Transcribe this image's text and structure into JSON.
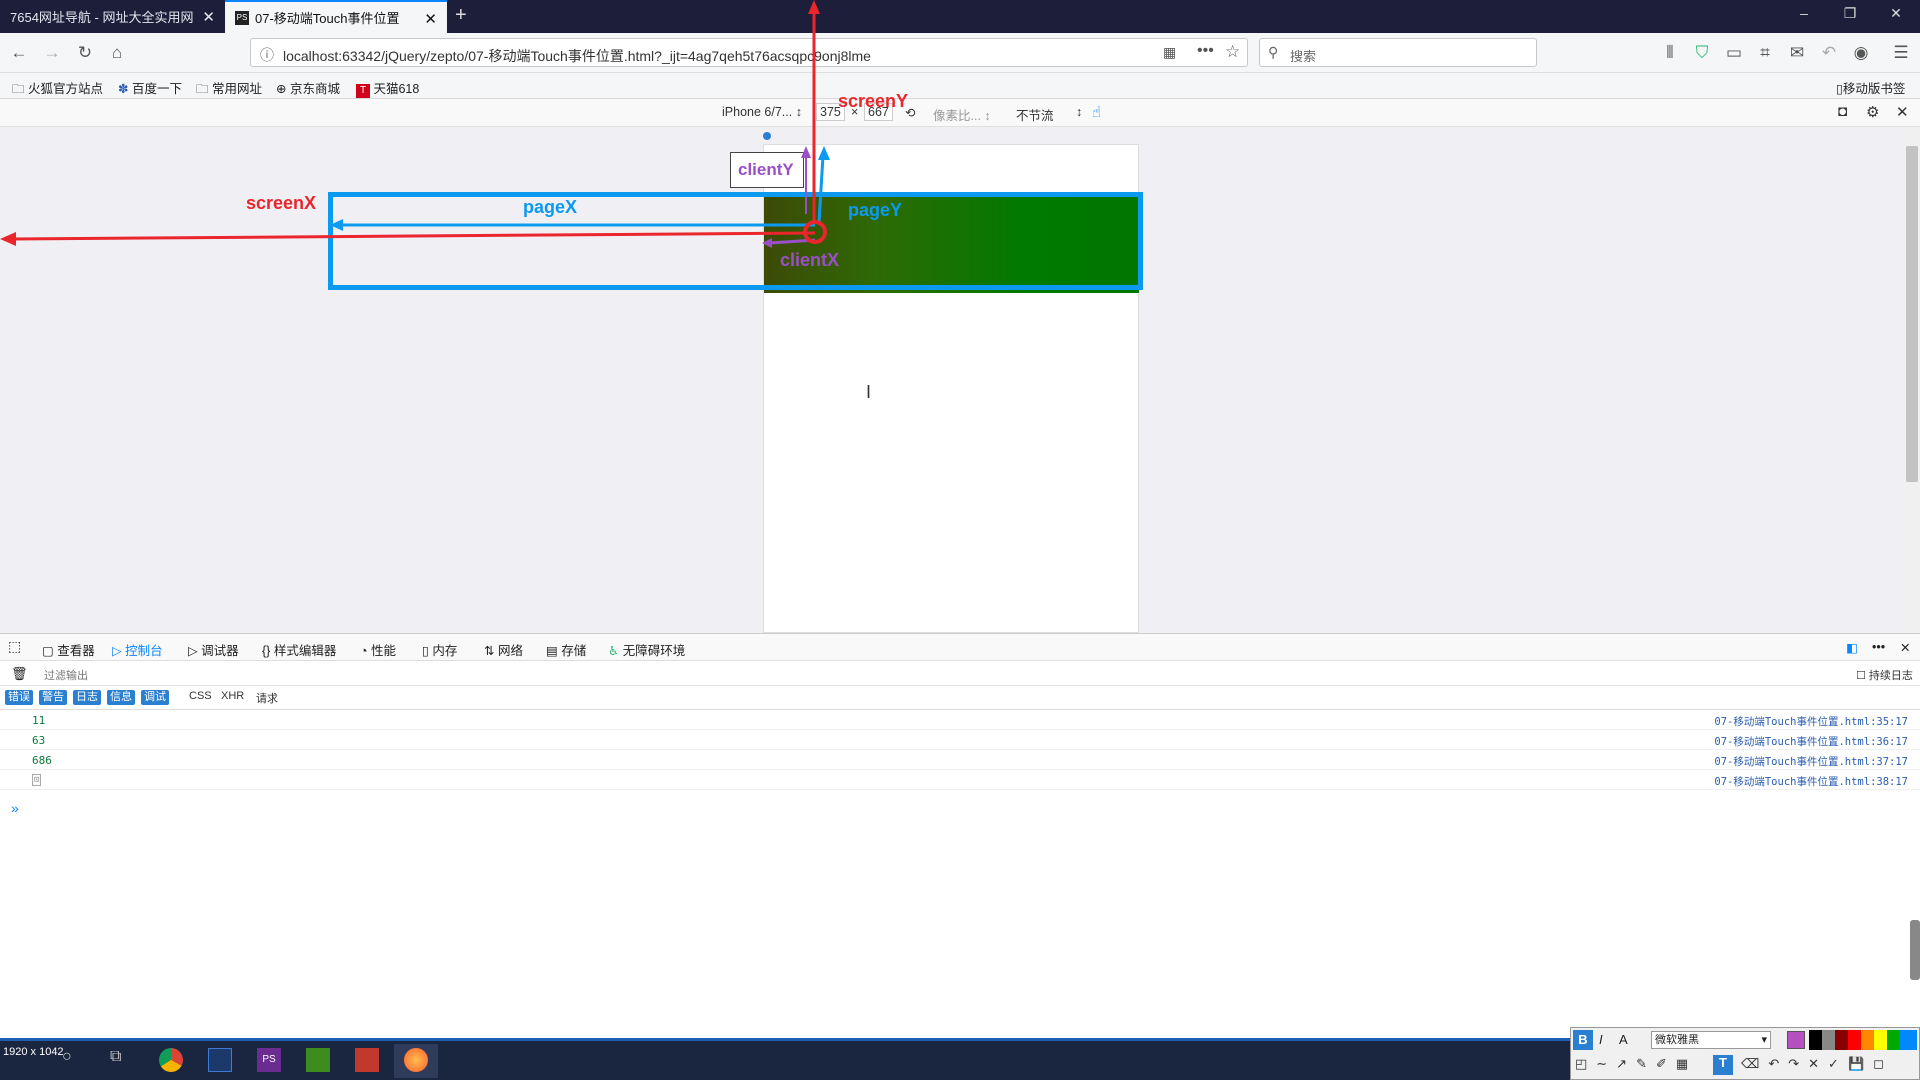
{
  "tabs": [
    {
      "title": "7654网址导航 - 网址大全实用网"
    },
    {
      "title": "07-移动端Touch事件位置"
    }
  ],
  "new_tab_icon": "plus-icon",
  "nav": {
    "url": "localhost:63342/jQuery/zepto/07-移动端Touch事件位置.html?_ijt=4ag7qeh5t76acsqpc9onj8lme",
    "search_placeholder": "搜索"
  },
  "bookmarks": [
    "火狐官方站点",
    "百度一下",
    "常用网址",
    "京东商城",
    "天猫618"
  ],
  "mobile_bookmarks": "移动版书签",
  "rdm": {
    "device": "iPhone 6/7...",
    "width": "375",
    "times": "×",
    "height": "667",
    "dpr": "像素比...",
    "throttle": "不节流"
  },
  "annotations": {
    "screenX": "screenX",
    "screenY": "screenY",
    "pageX": "pageX",
    "pageY": "pageY",
    "clientX": "clientX",
    "clientY": "clientY"
  },
  "devtools": {
    "tabs": [
      "查看器",
      "控制台",
      "调试器",
      "样式编辑器",
      "性能",
      "内存",
      "网络",
      "存储",
      "无障碍环境"
    ],
    "active_tab": "控制台",
    "filter_placeholder": "过滤输出",
    "persist_log": "持续日志",
    "levels": [
      "错误",
      "警告",
      "日志",
      "信息",
      "调试"
    ],
    "types": [
      "CSS",
      "XHR",
      "请求"
    ],
    "log": [
      {
        "value": "11",
        "source": "07-移动端Touch事件位置.html:35:17"
      },
      {
        "value": "63",
        "source": "07-移动端Touch事件位置.html:36:17"
      },
      {
        "value": "686",
        "source": "07-移动端Touch事件位置.html:37:17"
      },
      {
        "value": "",
        "source": "07-移动端Touch事件位置.html:38:17"
      }
    ],
    "prompt": "»"
  },
  "screen_size": "1920 x 1042",
  "paint_toolbar": {
    "font": "微软雅黑"
  },
  "colors": {
    "accent": "#0a84ff",
    "annotation_red": "#e8262c",
    "annotation_blue": "#0b9af0",
    "annotation_purple": "#9b4fc7"
  }
}
